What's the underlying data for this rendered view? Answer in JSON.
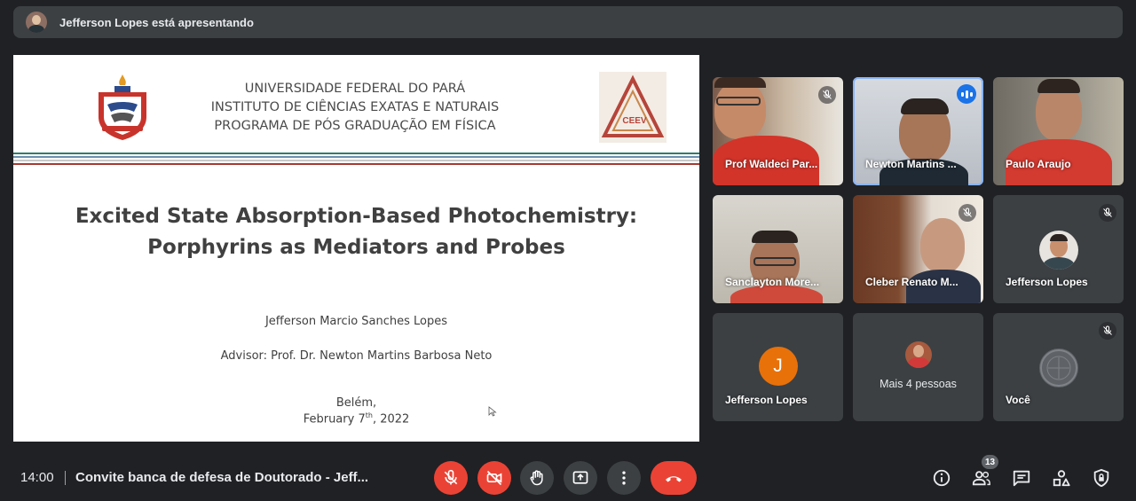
{
  "banner": {
    "text": "Jefferson Lopes está apresentando"
  },
  "slide": {
    "institution_lines": [
      "UNIVERSIDADE FEDERAL DO PARÁ",
      "INSTITUTO DE CIÊNCIAS EXATAS E NATURAIS",
      "PROGRAMA DE PÓS GRADUAÇÃO EM FÍSICA"
    ],
    "logo_text": "CEEV",
    "title_lines": [
      "Excited State Absorption-Based Photochemistry:",
      "Porphyrins as Mediators and Probes"
    ],
    "author": "Jefferson Marcio Sanches Lopes",
    "advisor": "Advisor: Prof. Dr. Newton Martins Barbosa Neto",
    "place": "Belém,",
    "date_prefix": "February 7",
    "date_sup": "th",
    "date_suffix": ", 2022",
    "stripe_colors": [
      "#2e7d6b",
      "#6c8fb0",
      "#c9c9c9",
      "#a53a2f"
    ]
  },
  "participants": [
    {
      "name": "Prof Waldeci Par...",
      "muted": true,
      "video": true
    },
    {
      "name": "Newton Martins ...",
      "speaking": true,
      "video": true
    },
    {
      "name": "Paulo Araujo",
      "video": true
    },
    {
      "name": "Sanclayton More...",
      "video": true
    },
    {
      "name": "Cleber Renato M...",
      "muted": true,
      "video": true
    },
    {
      "name": "Jefferson Lopes",
      "muted": true,
      "video": false
    },
    {
      "name": "Jefferson Lopes",
      "initial": "J",
      "video": false
    },
    {
      "name": "Mais 4 pessoas"
    },
    {
      "name": "Você",
      "muted": true,
      "video": false
    }
  ],
  "bottom_bar": {
    "time": "14:00",
    "meeting_title": "Convite banca de defesa de Doutorado - Jeff...",
    "people_count": "13"
  },
  "colors": {
    "danger": "#ea4335",
    "accent": "#8ab4f8",
    "surface": "#3c4043",
    "background": "#202124",
    "avatar_orange": "#e8710a"
  }
}
